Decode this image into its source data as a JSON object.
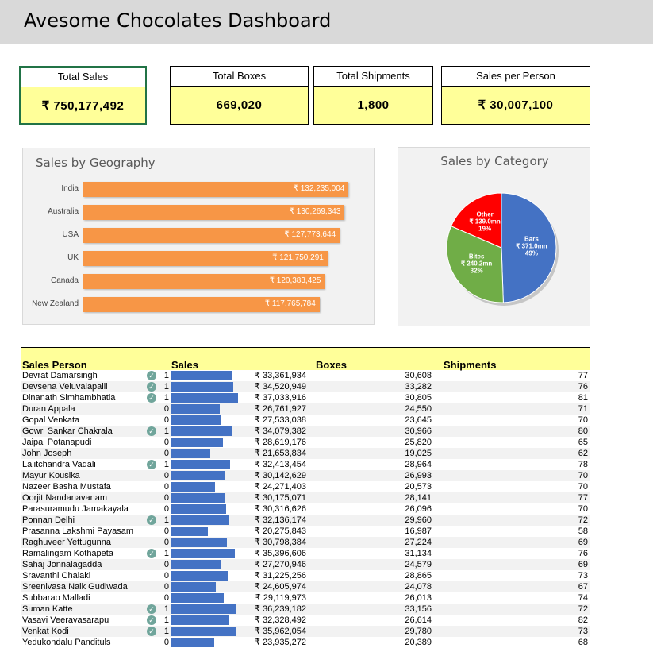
{
  "title": "Avesome Chocolates Dashboard",
  "kpis": [
    {
      "label": "Total Sales",
      "value": "₹ 750,177,492"
    },
    {
      "label": "Total Boxes",
      "value": "669,020"
    },
    {
      "label": "Total Shipments",
      "value": "1,800"
    },
    {
      "label": "Sales per Person",
      "value": "₹ 30,007,100"
    }
  ],
  "colors": {
    "accent": "#f79646",
    "kpi_fill": "#ffff99",
    "bar_blue": "#4472c4",
    "bars_slice": "#4472c4",
    "bites_slice": "#70ad47",
    "other_slice": "#ff0000"
  },
  "chart_data": [
    {
      "type": "bar",
      "title": "Sales by Geography",
      "categories": [
        "India",
        "Australia",
        "USA",
        "UK",
        "Canada",
        "New Zealand"
      ],
      "values": [
        132235004,
        130269343,
        127773644,
        121750291,
        120383425,
        117765784
      ],
      "labels": [
        "₹ 132,235,004",
        "₹ 130,269,343",
        "₹ 127,773,644",
        "₹ 121,750,291",
        "₹ 120,383,425",
        "₹ 117,765,784"
      ],
      "xlim": [
        0,
        140000000
      ]
    },
    {
      "type": "pie",
      "title": "Sales by Category",
      "slices": [
        {
          "name": "Bars",
          "value": 371.0,
          "label_value": "₹ 371.0mn",
          "percent": "49%",
          "color": "#4472c4"
        },
        {
          "name": "Bites",
          "value": 240.2,
          "label_value": "₹ 240.2mn",
          "percent": "32%",
          "color": "#70ad47"
        },
        {
          "name": "Other",
          "value": 139.0,
          "label_value": "₹ 139.0mn",
          "percent": "19%",
          "color": "#ff0000"
        }
      ]
    }
  ],
  "table": {
    "headers": {
      "person": "Sales Person",
      "sales": "Sales",
      "boxes": "Boxes",
      "shipments": "Shipments"
    },
    "rows": [
      {
        "name": "Devrat Damarsingh",
        "flag": "1",
        "sales": 33361934,
        "sales_text": "₹ 33,361,934",
        "boxes": "30,608",
        "shipments": "77"
      },
      {
        "name": "Devsena Veluvalapalli",
        "flag": "1",
        "sales": 34520949,
        "sales_text": "₹ 34,520,949",
        "boxes": "33,282",
        "shipments": "76"
      },
      {
        "name": "Dinanath Simhambhatla",
        "flag": "1",
        "sales": 37033916,
        "sales_text": "₹ 37,033,916",
        "boxes": "30,805",
        "shipments": "81"
      },
      {
        "name": "Duran Appala",
        "flag": "0",
        "sales": 26761927,
        "sales_text": "₹ 26,761,927",
        "boxes": "24,550",
        "shipments": "71"
      },
      {
        "name": "Gopal Venkata",
        "flag": "0",
        "sales": 27533038,
        "sales_text": "₹ 27,533,038",
        "boxes": "23,645",
        "shipments": "70"
      },
      {
        "name": "Gowri Sankar Chakrala",
        "flag": "1",
        "sales": 34079382,
        "sales_text": "₹ 34,079,382",
        "boxes": "30,966",
        "shipments": "80"
      },
      {
        "name": "Jaipal Potanapudi",
        "flag": "0",
        "sales": 28619176,
        "sales_text": "₹ 28,619,176",
        "boxes": "25,820",
        "shipments": "65"
      },
      {
        "name": "John Joseph",
        "flag": "0",
        "sales": 21653834,
        "sales_text": "₹ 21,653,834",
        "boxes": "19,025",
        "shipments": "62"
      },
      {
        "name": "Lalitchandra Vadali",
        "flag": "1",
        "sales": 32413454,
        "sales_text": "₹ 32,413,454",
        "boxes": "28,964",
        "shipments": "78"
      },
      {
        "name": "Mayur Kousika",
        "flag": "0",
        "sales": 30142629,
        "sales_text": "₹ 30,142,629",
        "boxes": "26,993",
        "shipments": "70"
      },
      {
        "name": "Nazeer Basha Mustafa",
        "flag": "0",
        "sales": 24271403,
        "sales_text": "₹ 24,271,403",
        "boxes": "20,573",
        "shipments": "70"
      },
      {
        "name": "Oorjit Nandanavanam",
        "flag": "0",
        "sales": 30175071,
        "sales_text": "₹ 30,175,071",
        "boxes": "28,141",
        "shipments": "77"
      },
      {
        "name": "Parasuramudu Jamakayala",
        "flag": "0",
        "sales": 30316626,
        "sales_text": "₹ 30,316,626",
        "boxes": "26,096",
        "shipments": "70"
      },
      {
        "name": "Ponnan Delhi",
        "flag": "1",
        "sales": 32136174,
        "sales_text": "₹ 32,136,174",
        "boxes": "29,960",
        "shipments": "72"
      },
      {
        "name": "Prasanna Lakshmi Payasam",
        "flag": "0",
        "sales": 20275843,
        "sales_text": "₹ 20,275,843",
        "boxes": "16,987",
        "shipments": "58"
      },
      {
        "name": "Raghuveer Yettugunna",
        "flag": "0",
        "sales": 30798384,
        "sales_text": "₹ 30,798,384",
        "boxes": "27,224",
        "shipments": "69"
      },
      {
        "name": "Ramalingam Kothapeta",
        "flag": "1",
        "sales": 35396606,
        "sales_text": "₹ 35,396,606",
        "boxes": "31,134",
        "shipments": "76"
      },
      {
        "name": "Sahaj Jonnalagadda",
        "flag": "0",
        "sales": 27270946,
        "sales_text": "₹ 27,270,946",
        "boxes": "24,579",
        "shipments": "69"
      },
      {
        "name": "Sravanthi Chalaki",
        "flag": "0",
        "sales": 31225256,
        "sales_text": "₹ 31,225,256",
        "boxes": "28,865",
        "shipments": "73"
      },
      {
        "name": "Sreenivasa Naik Gudiwada",
        "flag": "0",
        "sales": 24605974,
        "sales_text": "₹ 24,605,974",
        "boxes": "24,078",
        "shipments": "67"
      },
      {
        "name": "Subbarao Malladi",
        "flag": "0",
        "sales": 29119973,
        "sales_text": "₹ 29,119,973",
        "boxes": "26,013",
        "shipments": "74"
      },
      {
        "name": "Suman Katte",
        "flag": "1",
        "sales": 36239182,
        "sales_text": "₹ 36,239,182",
        "boxes": "33,156",
        "shipments": "72"
      },
      {
        "name": "Vasavi Veeravasarapu",
        "flag": "1",
        "sales": 32328492,
        "sales_text": "₹ 32,328,492",
        "boxes": "26,614",
        "shipments": "82"
      },
      {
        "name": "Venkat Kodi",
        "flag": "1",
        "sales": 35962054,
        "sales_text": "₹ 35,962,054",
        "boxes": "29,780",
        "shipments": "73"
      },
      {
        "name": "Yedukondalu Pandituls",
        "flag": "0",
        "sales": 23935272,
        "sales_text": "₹ 23,935,272",
        "boxes": "20,389",
        "shipments": "68"
      }
    ],
    "sales_scale_max": 37033916
  }
}
